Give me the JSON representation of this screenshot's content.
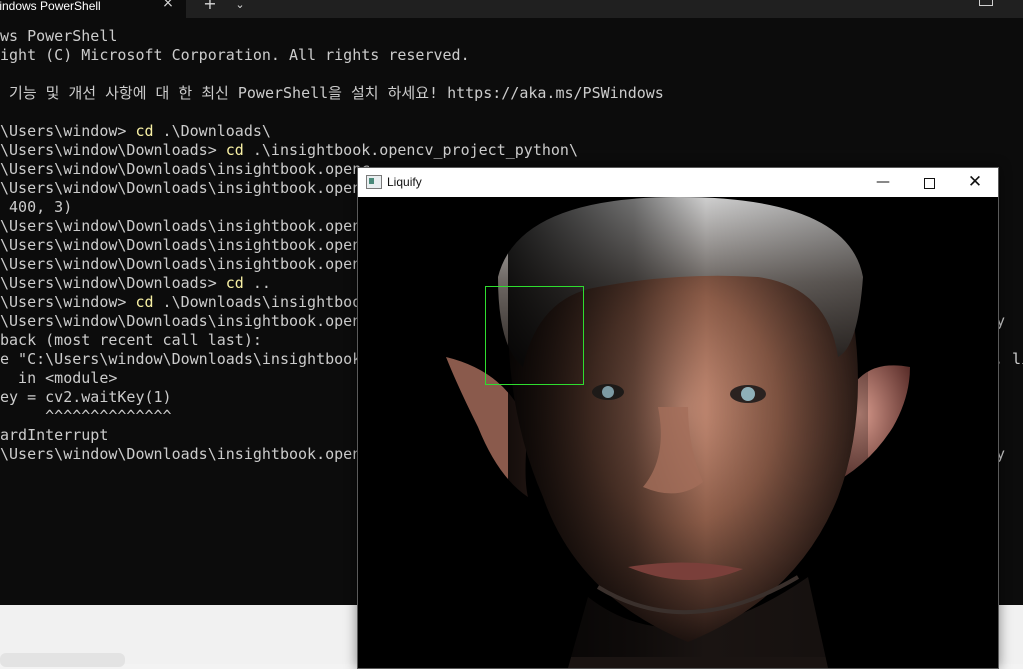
{
  "terminal": {
    "tab_title": "Windows PowerShell",
    "tab_close_icon": "×",
    "new_tab_icon": "+",
    "dropdown_icon": "⌄",
    "lines": [
      {
        "pre": "ws PowerShell",
        "cmd": "",
        "post": ""
      },
      {
        "pre": "ight (C) Microsoft Corporation. All rights reserved.",
        "cmd": "",
        "post": ""
      },
      {
        "pre": "",
        "cmd": "",
        "post": ""
      },
      {
        "pre": " 기능 및 개선 사항에 대 한 최신 PowerShell을 설치 하세요! https://aka.ms/PSWindows",
        "cmd": "",
        "post": ""
      },
      {
        "pre": "",
        "cmd": "",
        "post": ""
      },
      {
        "pre": "\\Users\\window> ",
        "cmd": "cd",
        "post": " .\\Downloads\\"
      },
      {
        "pre": "\\Users\\window\\Downloads> ",
        "cmd": "cd",
        "post": " .\\insightbook.opencv_project_python\\"
      },
      {
        "pre": "\\Users\\window\\Downloads\\insightbook.openc",
        "cmd": "",
        "post": ""
      },
      {
        "pre": "\\Users\\window\\Downloads\\insightbook.openc",
        "cmd": "",
        "post": ""
      },
      {
        "pre": " 400, 3)",
        "cmd": "",
        "post": ""
      },
      {
        "pre": "\\Users\\window\\Downloads\\insightbook.openc",
        "cmd": "",
        "post": ""
      },
      {
        "pre": "\\Users\\window\\Downloads\\insightbook.openc",
        "cmd": "",
        "post": ""
      },
      {
        "pre": "\\Users\\window\\Downloads\\insightbook.openc",
        "cmd": "",
        "post": ""
      },
      {
        "pre": "\\Users\\window\\Downloads> ",
        "cmd": "cd",
        "post": " .."
      },
      {
        "pre": "\\Users\\window> ",
        "cmd": "cd",
        "post": " .\\Downloads\\insightbook"
      },
      {
        "pre": "\\Users\\window\\Downloads\\insightbook.openc",
        "cmd": "",
        "post": ""
      },
      {
        "pre": "back (most recent call last):",
        "cmd": "",
        "post": ""
      },
      {
        "pre": "e \"C:\\Users\\window\\Downloads\\insightbook",
        "cmd": "",
        "post": ""
      },
      {
        "pre": "  in <module>",
        "cmd": "",
        "post": ""
      },
      {
        "pre": "ey = cv2.waitKey(1)",
        "cmd": "",
        "post": ""
      },
      {
        "pre": "     ^^^^^^^^^^^^^^",
        "cmd": "",
        "post": ""
      },
      {
        "pre": "ardInterrupt",
        "cmd": "",
        "post": ""
      },
      {
        "pre": "\\Users\\window\\Downloads\\insightbook.openc",
        "cmd": "",
        "post": ""
      }
    ],
    "right_fragments": {
      "py_1": "py",
      "li": ", li",
      "py_2": "py"
    }
  },
  "liquify": {
    "title": "Liquify",
    "minimize_icon": "—",
    "close_icon": "✕",
    "selection_color": "#2fdd2f"
  }
}
